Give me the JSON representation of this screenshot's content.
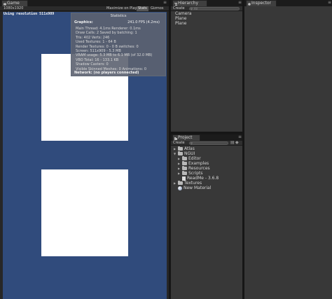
{
  "game": {
    "tab_label": "Game",
    "aspect": "1080x1920",
    "buttons": [
      "Maximize on Play",
      "Stats",
      "Gizmos"
    ],
    "resolution_text": "Using resolution 511x909",
    "stats": {
      "title": "Statistics",
      "graphics_label": "Graphics:",
      "fps": "241.0 FPS (4.2ms)",
      "lines": [
        "Main Thread: 4.1ms  Renderer: 0.1ms",
        "Draw Calls: 2   Saved by batching: 1",
        "Tris: 402   Verts: 246",
        "Used Textures: 1 - 64 B",
        "Render Textures: 0 - 0 B   switches: 0",
        "Screen: 511x909 - 5.3 MB",
        "VRAM usage: 5.3 MB to 6.1 MB (of 32.0 MB)",
        "VBO Total: 16 - 133.1 KB",
        "Shadow Casters: 0",
        "Visible Skinned Meshes: 0      Animations: 0"
      ],
      "network": "Network: (no players connected)"
    }
  },
  "hierarchy": {
    "tab_label": "Hierarchy",
    "create_label": "Create",
    "search_placeholder": "All",
    "items": [
      "Camera",
      "Plane",
      "Plane"
    ]
  },
  "project": {
    "tab_label": "Project",
    "create_label": "Create",
    "items": [
      {
        "label": "Atlas",
        "type": "folder",
        "expanded": false,
        "indent": 0
      },
      {
        "label": "NGUI",
        "type": "folder",
        "expanded": true,
        "indent": 0
      },
      {
        "label": "Editor",
        "type": "folder",
        "expanded": false,
        "indent": 1
      },
      {
        "label": "Examples",
        "type": "folder",
        "expanded": false,
        "indent": 1
      },
      {
        "label": "Resources",
        "type": "folder",
        "expanded": false,
        "indent": 1
      },
      {
        "label": "Scripts",
        "type": "folder",
        "expanded": false,
        "indent": 1
      },
      {
        "label": "ReadMe - 3.6.8",
        "type": "file",
        "expanded": null,
        "indent": 1
      },
      {
        "label": "Textures",
        "type": "folder",
        "expanded": false,
        "indent": 0
      },
      {
        "label": "New Material",
        "type": "material",
        "expanded": null,
        "indent": 0
      }
    ]
  },
  "inspector": {
    "tab_label": "Inspector"
  },
  "colors": {
    "viewport_blue": "#304b7c",
    "panel_bg": "#383838",
    "tab_bar": "#1b1b1b"
  }
}
